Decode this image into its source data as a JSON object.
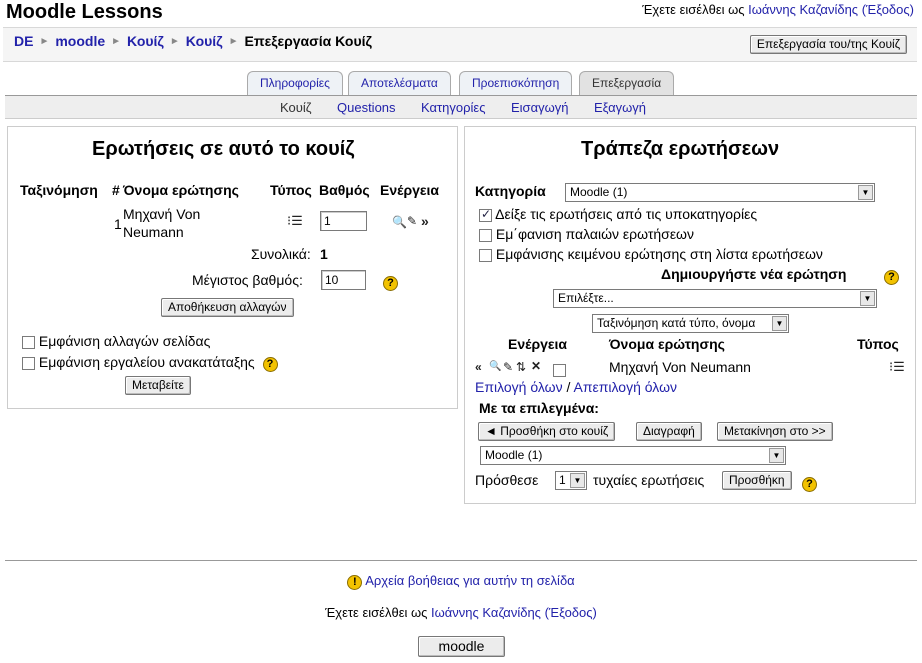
{
  "header": {
    "site_title": "Moodle Lessons",
    "login_prefix": "Έχετε εισέλθει ως ",
    "user_name": "Ιωάννης Καζανίδης",
    "logout": "(Έξοδος)"
  },
  "breadcrumb": {
    "items": [
      "DE",
      "moodle",
      "Κουίζ",
      "Κουίζ"
    ],
    "current": "Επεξεργασία Κουίζ"
  },
  "edit_quiz_button": "Επεξεργασία του/της Κουίζ",
  "tabs": [
    "Πληροφορίες",
    "Αποτελέσματα",
    "Προεπισκόπηση",
    "Επεξεργασία"
  ],
  "subtabs": [
    "Κουίζ",
    "Questions",
    "Κατηγορίες",
    "Εισαγωγή",
    "Εξαγωγή"
  ],
  "left": {
    "title": "Ερωτήσεις σε αυτό το κουίζ",
    "headers": {
      "order": "Ταξινόμηση",
      "num": "#",
      "name": "Όνομα ερώτησης",
      "type": "Τύπος",
      "grade": "Βαθμός",
      "action": "Ενέργεια"
    },
    "row": {
      "num": "1",
      "name_line1": "Μηχανή Von",
      "name_line2": "Neumann",
      "grade": "1"
    },
    "total_label": "Συνολικά:",
    "total_value": "1",
    "max_grade_label": "Μέγιστος βαθμός:",
    "max_grade_value": "10",
    "save_button": "Αποθήκευση αλλαγών",
    "show_page_breaks": "Εμφάνιση αλλαγών σελίδας",
    "show_reorder_tool": "Εμφάνιση εργαλείου ανακατάταξης",
    "go_button": "Μεταβείτε"
  },
  "right": {
    "title": "Τράπεζα ερωτήσεων",
    "category_label": "Κατηγορία",
    "category_value": "Moodle (1)",
    "opt_subcategories": "Δείξε τις ερωτήσεις από τις υποκατηγορίες",
    "opt_old": "Εμ΄φανιση παλαιών ερωτήσεων",
    "opt_text": "Εμφάνισης κειμένου ερώτησης στη λίστα ερωτήσεων",
    "create_label": "Δημιουργήστε νέα ερώτηση",
    "create_select": "Επιλέξτε...",
    "sort_select": "Ταξινόμηση κατά τύπο, όνομα",
    "headers": {
      "action": "Ενέργεια",
      "name": "Όνομα ερώτησης",
      "type": "Τύπος"
    },
    "row": {
      "name": "Μηχανή Von Neumann"
    },
    "select_all": "Επιλογή όλων",
    "deselect_all": "Απεπιλογή όλων",
    "with_selected": "Με τα επιλεγμένα:",
    "add_to_quiz": "◄ Προσθήκη στο κουίζ",
    "delete": "Διαγραφή",
    "move_to": "Μετακίνηση στο >>",
    "move_target": "Moodle (1)",
    "add_label": "Πρόσθεσε",
    "random_count": "1",
    "random_label": "τυχαίες ερωτήσεις",
    "add_button": "Προσθήκη"
  },
  "footer": {
    "help_link": "Αρχεία βοήθειας για αυτήν τη σελίδα",
    "home_button": "moodle"
  }
}
